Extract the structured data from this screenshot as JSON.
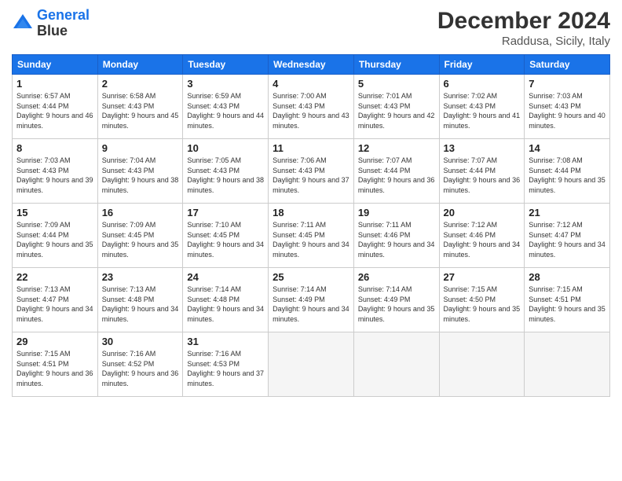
{
  "header": {
    "logo_line1": "General",
    "logo_line2": "Blue",
    "month_title": "December 2024",
    "location": "Raddusa, Sicily, Italy"
  },
  "weekdays": [
    "Sunday",
    "Monday",
    "Tuesday",
    "Wednesday",
    "Thursday",
    "Friday",
    "Saturday"
  ],
  "weeks": [
    [
      {
        "day": "1",
        "sunrise": "6:57 AM",
        "sunset": "4:44 PM",
        "daylight": "9 hours and 46 minutes."
      },
      {
        "day": "2",
        "sunrise": "6:58 AM",
        "sunset": "4:43 PM",
        "daylight": "9 hours and 45 minutes."
      },
      {
        "day": "3",
        "sunrise": "6:59 AM",
        "sunset": "4:43 PM",
        "daylight": "9 hours and 44 minutes."
      },
      {
        "day": "4",
        "sunrise": "7:00 AM",
        "sunset": "4:43 PM",
        "daylight": "9 hours and 43 minutes."
      },
      {
        "day": "5",
        "sunrise": "7:01 AM",
        "sunset": "4:43 PM",
        "daylight": "9 hours and 42 minutes."
      },
      {
        "day": "6",
        "sunrise": "7:02 AM",
        "sunset": "4:43 PM",
        "daylight": "9 hours and 41 minutes."
      },
      {
        "day": "7",
        "sunrise": "7:03 AM",
        "sunset": "4:43 PM",
        "daylight": "9 hours and 40 minutes."
      }
    ],
    [
      {
        "day": "8",
        "sunrise": "7:03 AM",
        "sunset": "4:43 PM",
        "daylight": "9 hours and 39 minutes."
      },
      {
        "day": "9",
        "sunrise": "7:04 AM",
        "sunset": "4:43 PM",
        "daylight": "9 hours and 38 minutes."
      },
      {
        "day": "10",
        "sunrise": "7:05 AM",
        "sunset": "4:43 PM",
        "daylight": "9 hours and 38 minutes."
      },
      {
        "day": "11",
        "sunrise": "7:06 AM",
        "sunset": "4:43 PM",
        "daylight": "9 hours and 37 minutes."
      },
      {
        "day": "12",
        "sunrise": "7:07 AM",
        "sunset": "4:44 PM",
        "daylight": "9 hours and 36 minutes."
      },
      {
        "day": "13",
        "sunrise": "7:07 AM",
        "sunset": "4:44 PM",
        "daylight": "9 hours and 36 minutes."
      },
      {
        "day": "14",
        "sunrise": "7:08 AM",
        "sunset": "4:44 PM",
        "daylight": "9 hours and 35 minutes."
      }
    ],
    [
      {
        "day": "15",
        "sunrise": "7:09 AM",
        "sunset": "4:44 PM",
        "daylight": "9 hours and 35 minutes."
      },
      {
        "day": "16",
        "sunrise": "7:09 AM",
        "sunset": "4:45 PM",
        "daylight": "9 hours and 35 minutes."
      },
      {
        "day": "17",
        "sunrise": "7:10 AM",
        "sunset": "4:45 PM",
        "daylight": "9 hours and 34 minutes."
      },
      {
        "day": "18",
        "sunrise": "7:11 AM",
        "sunset": "4:45 PM",
        "daylight": "9 hours and 34 minutes."
      },
      {
        "day": "19",
        "sunrise": "7:11 AM",
        "sunset": "4:46 PM",
        "daylight": "9 hours and 34 minutes."
      },
      {
        "day": "20",
        "sunrise": "7:12 AM",
        "sunset": "4:46 PM",
        "daylight": "9 hours and 34 minutes."
      },
      {
        "day": "21",
        "sunrise": "7:12 AM",
        "sunset": "4:47 PM",
        "daylight": "9 hours and 34 minutes."
      }
    ],
    [
      {
        "day": "22",
        "sunrise": "7:13 AM",
        "sunset": "4:47 PM",
        "daylight": "9 hours and 34 minutes."
      },
      {
        "day": "23",
        "sunrise": "7:13 AM",
        "sunset": "4:48 PM",
        "daylight": "9 hours and 34 minutes."
      },
      {
        "day": "24",
        "sunrise": "7:14 AM",
        "sunset": "4:48 PM",
        "daylight": "9 hours and 34 minutes."
      },
      {
        "day": "25",
        "sunrise": "7:14 AM",
        "sunset": "4:49 PM",
        "daylight": "9 hours and 34 minutes."
      },
      {
        "day": "26",
        "sunrise": "7:14 AM",
        "sunset": "4:49 PM",
        "daylight": "9 hours and 35 minutes."
      },
      {
        "day": "27",
        "sunrise": "7:15 AM",
        "sunset": "4:50 PM",
        "daylight": "9 hours and 35 minutes."
      },
      {
        "day": "28",
        "sunrise": "7:15 AM",
        "sunset": "4:51 PM",
        "daylight": "9 hours and 35 minutes."
      }
    ],
    [
      {
        "day": "29",
        "sunrise": "7:15 AM",
        "sunset": "4:51 PM",
        "daylight": "9 hours and 36 minutes."
      },
      {
        "day": "30",
        "sunrise": "7:16 AM",
        "sunset": "4:52 PM",
        "daylight": "9 hours and 36 minutes."
      },
      {
        "day": "31",
        "sunrise": "7:16 AM",
        "sunset": "4:53 PM",
        "daylight": "9 hours and 37 minutes."
      },
      null,
      null,
      null,
      null
    ]
  ]
}
